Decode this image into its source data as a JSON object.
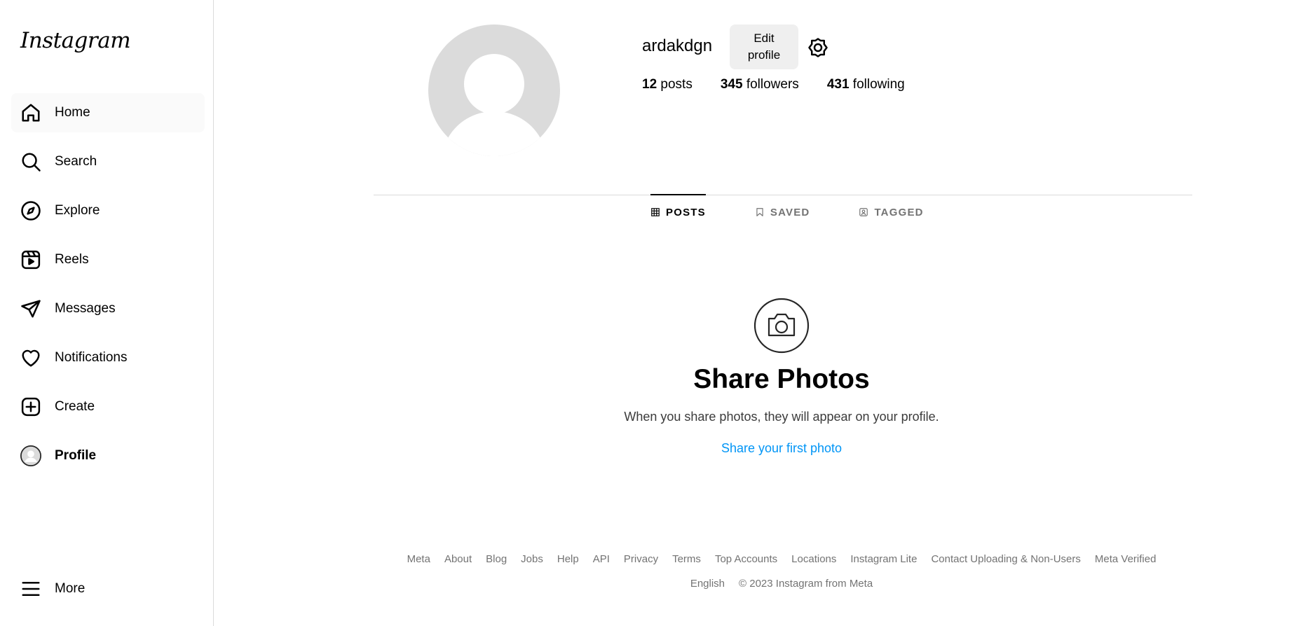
{
  "sidebar": {
    "logo": "Instagram",
    "items": [
      {
        "label": "Home",
        "icon": "home-icon"
      },
      {
        "label": "Search",
        "icon": "search-icon"
      },
      {
        "label": "Explore",
        "icon": "compass-icon"
      },
      {
        "label": "Reels",
        "icon": "reels-icon"
      },
      {
        "label": "Messages",
        "icon": "send-icon"
      },
      {
        "label": "Notifications",
        "icon": "heart-icon"
      },
      {
        "label": "Create",
        "icon": "plus-square-icon"
      },
      {
        "label": "Profile",
        "icon": "avatar"
      }
    ],
    "more": {
      "label": "More",
      "icon": "menu-icon"
    }
  },
  "profile": {
    "username": "ardakdgn",
    "edit_button": "Edit profile",
    "edit_line1": "Edit",
    "edit_line2": "profile",
    "stats": {
      "posts_count": "12",
      "posts_label": "posts",
      "followers_count": "345",
      "followers_label": "followers",
      "following_count": "431",
      "following_label": "following"
    }
  },
  "tabs": [
    {
      "label": "POSTS",
      "icon": "grid-icon",
      "active": true
    },
    {
      "label": "SAVED",
      "icon": "bookmark-icon",
      "active": false
    },
    {
      "label": "TAGGED",
      "icon": "tag-user-icon",
      "active": false
    }
  ],
  "empty_state": {
    "icon": "camera-icon",
    "title": "Share Photos",
    "subtitle": "When you share photos, they will appear on your profile.",
    "link": "Share your first photo"
  },
  "footer": {
    "links": [
      "Meta",
      "About",
      "Blog",
      "Jobs",
      "Help",
      "API",
      "Privacy",
      "Terms",
      "Top Accounts",
      "Locations",
      "Instagram Lite",
      "Contact Uploading & Non-Users",
      "Meta Verified"
    ],
    "language": "English",
    "copyright": "© 2023 Instagram from Meta"
  },
  "colors": {
    "link": "#0095f6",
    "border": "#dbdbdb",
    "muted": "#737373"
  }
}
